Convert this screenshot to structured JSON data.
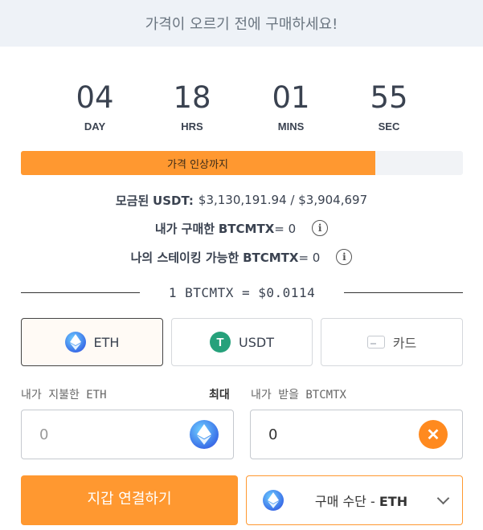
{
  "banner": {
    "text": "가격이 오르기 전에 구매하세요!"
  },
  "countdown": [
    {
      "value": "04",
      "label": "DAY"
    },
    {
      "value": "18",
      "label": "HRS"
    },
    {
      "value": "01",
      "label": "MINS"
    },
    {
      "value": "55",
      "label": "SEC"
    }
  ],
  "progress": {
    "label": "가격 인상까지",
    "fraction": 0.802
  },
  "stats": {
    "raised_label": "모금된",
    "raised_token": "USDT:",
    "raised_value": "$3,130,191.94 / $3,904,697",
    "purchased_label": "내가 구매한",
    "purchased_token": "BTCMTX",
    "purchased_value": "= 0",
    "stakeable_label": "나의 스테이킹 가능한",
    "stakeable_token": "BTCMTX",
    "stakeable_value": "= 0",
    "info_glyph": "i"
  },
  "rate": {
    "text": "1 BTCMTX = $0.0114"
  },
  "tabs": [
    {
      "label": "ETH",
      "icon": "eth-icon",
      "active": true
    },
    {
      "label": "USDT",
      "icon": "usdt-icon",
      "active": false
    },
    {
      "label": "카드",
      "icon": "card-icon",
      "active": false
    }
  ],
  "usdt_glyph": "T",
  "pay": {
    "label": "내가 지불한 ETH",
    "max_label": "최대",
    "value": "0"
  },
  "receive": {
    "label": "내가 받을 BTCMTX",
    "value": "0"
  },
  "btc_glyph": "✕",
  "connect_button": {
    "label": "지갑 연결하기"
  },
  "method": {
    "prefix": "구매 수단 - ",
    "currency": "ETH"
  },
  "colors": {
    "accent": "#ff9830",
    "banner_bg": "#eef2f7",
    "usdt": "#26a17b"
  }
}
